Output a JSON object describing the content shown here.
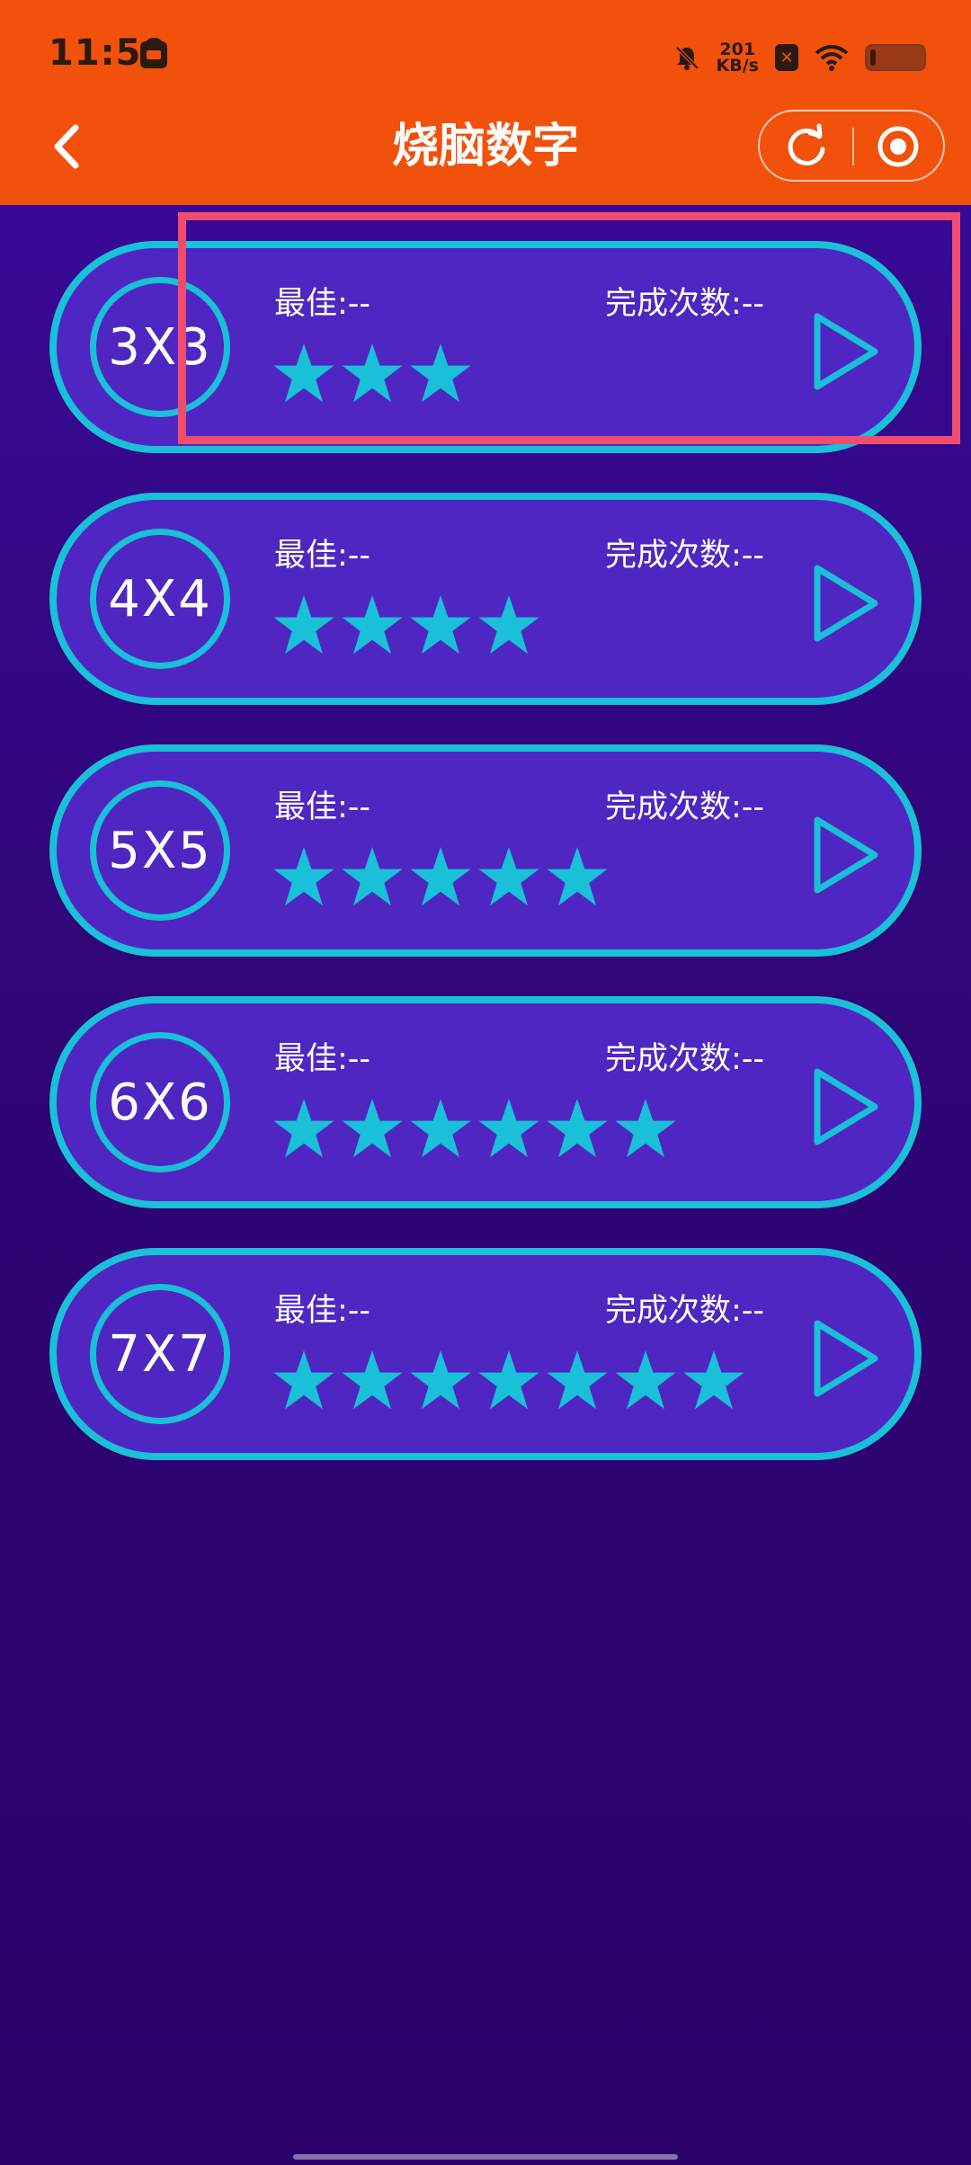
{
  "status_bar": {
    "time": "11:50",
    "network_speed_value": "201",
    "network_speed_unit": "KB/s"
  },
  "nav": {
    "title": "烧脑数字"
  },
  "levels": [
    {
      "size": "3X3",
      "best": "最佳:--",
      "completions": "完成次数:--",
      "stars": 3
    },
    {
      "size": "4X4",
      "best": "最佳:--",
      "completions": "完成次数:--",
      "stars": 4
    },
    {
      "size": "5X5",
      "best": "最佳:--",
      "completions": "完成次数:--",
      "stars": 5
    },
    {
      "size": "6X6",
      "best": "最佳:--",
      "completions": "完成次数:--",
      "stars": 6
    },
    {
      "size": "7X7",
      "best": "最佳:--",
      "completions": "完成次数:--",
      "stars": 7
    }
  ],
  "colors": {
    "header_bg": "#f2510b",
    "card_bg": "#4f26c2",
    "accent": "#19c0d8",
    "highlight": "#f04d6e"
  }
}
